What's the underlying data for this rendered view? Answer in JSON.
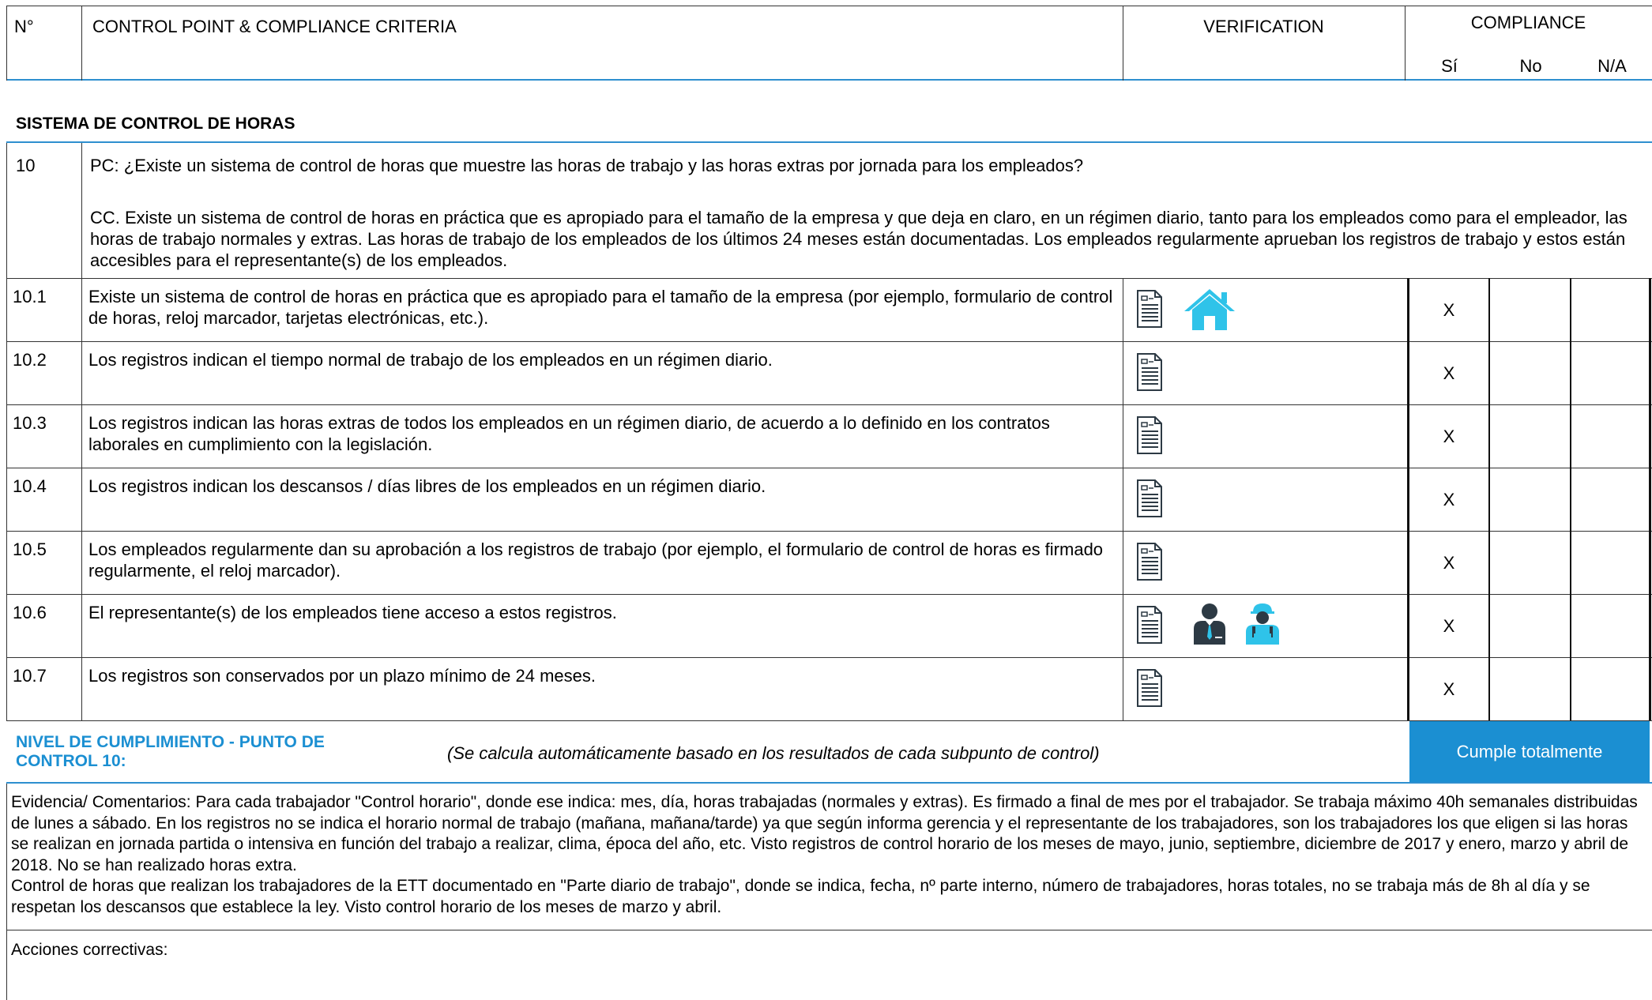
{
  "header": {
    "num": "N°",
    "criteria": "CONTROL POINT & COMPLIANCE CRITERIA",
    "verification": "VERIFICATION",
    "compliance": "COMPLIANCE",
    "si": "Sí",
    "no": "No",
    "na": "N/A"
  },
  "section_title": "SISTEMA DE CONTROL DE HORAS",
  "control_point": {
    "num": "10",
    "pc": "PC: ¿Existe un sistema de control de horas que muestre las horas de trabajo y las horas extras por jornada para los empleados?",
    "cc": "CC. Existe un sistema de control de horas en práctica que es apropiado para el tamaño de la empresa y que deja en claro, en un régimen diario, tanto para los empleados como para el empleador, las horas de trabajo normales y extras.  Las horas de trabajo de los empleados de los últimos 24 meses están documentadas. Los empleados regularmente aprueban los registros de trabajo y estos están accesibles para el representante(s) de los empleados."
  },
  "rows": [
    {
      "num": "10.1",
      "text": "Existe un sistema de control de horas en práctica que es apropiado para el tamaño de la empresa (por ejemplo, formulario de control de horas, reloj marcador, tarjetas electrónicas, etc.).",
      "si": "X",
      "icons": [
        "document-icon",
        "house-icon"
      ]
    },
    {
      "num": "10.2",
      "text": "Los registros indican el tiempo normal de trabajo de los empleados en un régimen diario.",
      "si": "X",
      "icons": [
        "document-icon"
      ]
    },
    {
      "num": "10.3",
      "text": "Los registros indican las horas extras de todos los empleados en un régimen diario, de acuerdo a lo definido en los contratos laborales en cumplimiento con la legislación.",
      "si": "X",
      "icons": [
        "document-icon"
      ]
    },
    {
      "num": "10.4",
      "text": "Los registros indican los descansos / días libres de los empleados en un régimen diario.",
      "si": "X",
      "icons": [
        "document-icon"
      ]
    },
    {
      "num": "10.5",
      "text": "Los empleados regularmente dan  su aprobación a los registros de trabajo (por ejemplo, el formulario de control de horas es firmado regularmente, el reloj marcador).",
      "si": "X",
      "icons": [
        "document-icon"
      ]
    },
    {
      "num": "10.6",
      "text": "El representante(s) de los empleados tiene acceso a estos registros.",
      "si": "X",
      "icons": [
        "document-icon",
        "manager-icon",
        "worker-icon"
      ]
    },
    {
      "num": "10.7",
      "text": "Los registros son conservados por un plazo mínimo de 24 meses.",
      "si": "X",
      "icons": [
        "document-icon"
      ]
    }
  ],
  "level": {
    "label": "NIVEL DE CUMPLIMIENTO - PUNTO DE CONTROL 10:",
    "note": "(Se calcula automáticamente basado en los resultados de cada subpunto de control)",
    "result": "Cumple totalmente"
  },
  "evidence": "Evidencia/ Comentarios: Para cada trabajador \"Control horario\", donde ese indica: mes, día, horas trabajadas (normales y extras). Es firmado a final de mes por el trabajador. Se trabaja máximo 40h semanales distribuidas de lunes a sábado. En los registros no se indica el horario normal de trabajo (mañana, mañana/tarde) ya que según informa gerencia y el representante de los trabajadores, son los trabajadores los que eligen si las horas se realizan en jornada partida o intensiva en función del trabajo a realizar, clima, época del año, etc. Visto registros de control horario de los meses de mayo, junio, septiembre, diciembre de 2017 y enero, marzo y abril de 2018. No se han realizado horas extra.\nControl de horas que realizan los trabajadores de la ETT documentado en \"Parte diario de trabajo\", donde se indica, fecha, nº parte interno, número de trabajadores, horas totales, no se trabaja más de 8h al día y se respetan los descansos que establece la ley. Visto control horario de los meses de marzo y abril.",
  "corrective": "Acciones correctivas:",
  "colors": {
    "accent": "#1b8fd2",
    "accent_bar": "#2e8fcf",
    "icon_teal": "#2fc3e9",
    "icon_dark": "#2d3a44"
  }
}
